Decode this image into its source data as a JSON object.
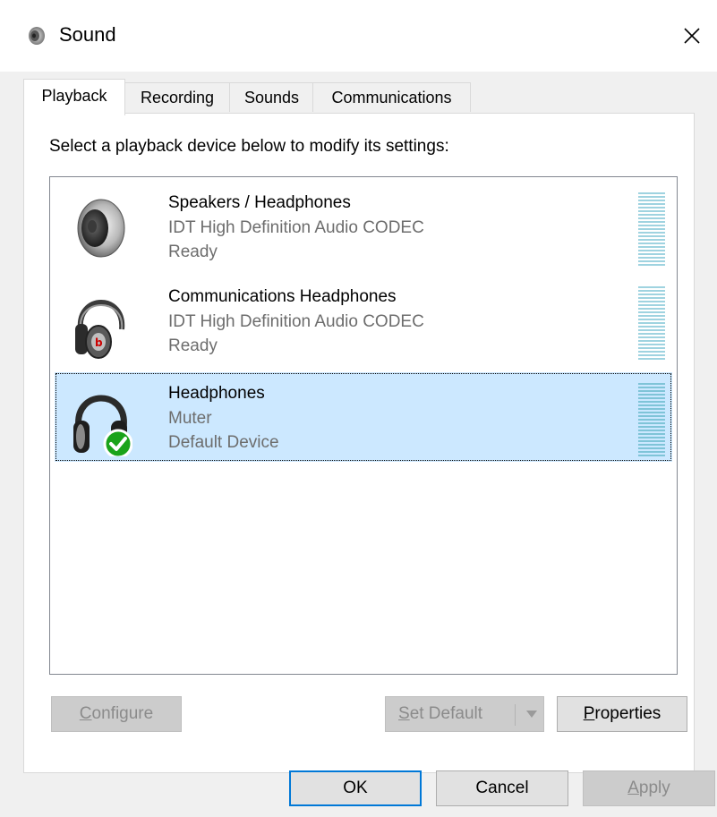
{
  "window": {
    "title": "Sound",
    "icon": "speaker-icon",
    "close_icon": "close-icon"
  },
  "tabs": [
    {
      "label": "Playback",
      "active": true
    },
    {
      "label": "Recording",
      "active": false
    },
    {
      "label": "Sounds",
      "active": false
    },
    {
      "label": "Communications",
      "active": false
    }
  ],
  "instructions": "Select a playback device below to modify its settings:",
  "devices": [
    {
      "name": "Speakers / Headphones",
      "description": "IDT High Definition Audio CODEC",
      "status": "Ready",
      "icon": "speaker-icon",
      "selected": false
    },
    {
      "name": "Communications Headphones",
      "description": "IDT High Definition Audio CODEC",
      "status": "Ready",
      "icon": "headphones-icon",
      "selected": false
    },
    {
      "name": "Headphones",
      "description": "Muter",
      "status": "Default Device",
      "icon": "headphones-default-icon",
      "selected": true
    }
  ],
  "buttons": {
    "configure": {
      "u": "C",
      "rest": "onfigure"
    },
    "set_default": {
      "u": "S",
      "rest": "et Default"
    },
    "properties": {
      "u": "P",
      "rest": "roperties"
    },
    "ok": "OK",
    "cancel": "Cancel",
    "apply": {
      "u": "A",
      "rest": "pply"
    }
  },
  "colors": {
    "selection": "#cce8ff",
    "accent": "#0078d7",
    "default_check": "#1aa31a"
  }
}
